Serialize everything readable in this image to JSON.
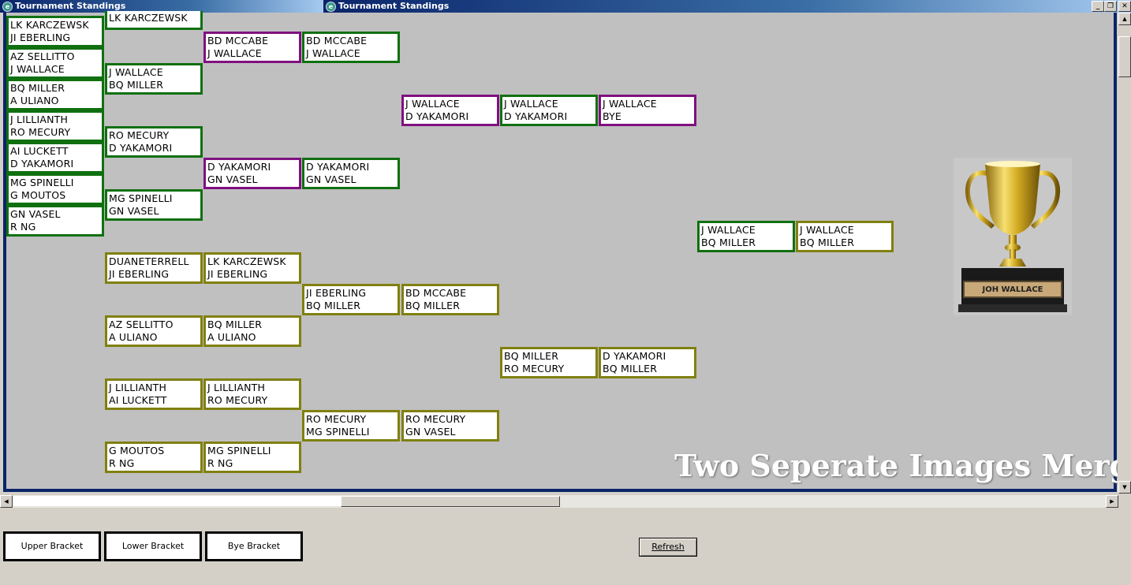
{
  "windows": [
    {
      "title": "Tournament Standings"
    },
    {
      "title": "Tournament Standings"
    }
  ],
  "window_controls": {
    "minimize": "_",
    "restore": "❐",
    "close": "✕"
  },
  "matches": [
    {
      "p1": "LK KARCZEWSK",
      "p2": "JI EBERLING",
      "bracket": "upper"
    },
    {
      "p1": "AZ SELLITTO",
      "p2": "J WALLACE",
      "bracket": "upper"
    },
    {
      "p1": "BQ MILLER",
      "p2": "A ULIANO",
      "bracket": "upper"
    },
    {
      "p1": "J LILLIANTH",
      "p2": "RO MECURY",
      "bracket": "upper"
    },
    {
      "p1": "AI LUCKETT",
      "p2": "D YAKAMORI",
      "bracket": "upper"
    },
    {
      "p1": "MG SPINELLI",
      "p2": "G MOUTOS",
      "bracket": "upper"
    },
    {
      "p1": "GN VASEL",
      "p2": "R NG",
      "bracket": "upper"
    },
    {
      "p1": "LK KARCZEWSK",
      "p2": "",
      "bracket": "upper"
    },
    {
      "p1": "J WALLACE",
      "p2": "BQ MILLER",
      "bracket": "upper"
    },
    {
      "p1": "RO MECURY",
      "p2": "D YAKAMORI",
      "bracket": "upper"
    },
    {
      "p1": "MG SPINELLI",
      "p2": "GN VASEL",
      "bracket": "upper"
    },
    {
      "p1": "BD MCCABE",
      "p2": "J WALLACE",
      "bracket": "bye"
    },
    {
      "p1": "D YAKAMORI",
      "p2": "GN VASEL",
      "bracket": "bye"
    },
    {
      "p1": "BD MCCABE",
      "p2": "J WALLACE",
      "bracket": "upper"
    },
    {
      "p1": "D YAKAMORI",
      "p2": "GN VASEL",
      "bracket": "upper"
    },
    {
      "p1": "J WALLACE",
      "p2": "D YAKAMORI",
      "bracket": "bye"
    },
    {
      "p1": "J WALLACE",
      "p2": "D YAKAMORI",
      "bracket": "upper"
    },
    {
      "p1": "J WALLACE",
      "p2": "BYE",
      "bracket": "bye"
    },
    {
      "p1": "J WALLACE",
      "p2": "BQ MILLER",
      "bracket": "upper"
    },
    {
      "p1": "J WALLACE",
      "p2": "BQ MILLER",
      "bracket": "lower"
    },
    {
      "p1": "DUANETERRELL",
      "p2": "JI EBERLING",
      "bracket": "lower"
    },
    {
      "p1": "AZ SELLITTO",
      "p2": "A ULIANO",
      "bracket": "lower"
    },
    {
      "p1": "J LILLIANTH",
      "p2": "AI LUCKETT",
      "bracket": "lower"
    },
    {
      "p1": "G MOUTOS",
      "p2": "R NG",
      "bracket": "lower"
    },
    {
      "p1": "LK KARCZEWSK",
      "p2": "JI EBERLING",
      "bracket": "lower"
    },
    {
      "p1": "BQ MILLER",
      "p2": "A ULIANO",
      "bracket": "lower"
    },
    {
      "p1": "J LILLIANTH",
      "p2": "RO MECURY",
      "bracket": "lower"
    },
    {
      "p1": "MG SPINELLI",
      "p2": "R NG",
      "bracket": "lower"
    },
    {
      "p1": "JI EBERLING",
      "p2": "BQ MILLER",
      "bracket": "lower"
    },
    {
      "p1": "RO MECURY",
      "p2": "MG SPINELLI",
      "bracket": "lower"
    },
    {
      "p1": "BD MCCABE",
      "p2": "BQ MILLER",
      "bracket": "lower"
    },
    {
      "p1": "RO MECURY",
      "p2": "GN VASEL",
      "bracket": "lower"
    },
    {
      "p1": "BQ MILLER",
      "p2": "RO MECURY",
      "bracket": "lower"
    },
    {
      "p1": "D YAKAMORI",
      "p2": "BQ MILLER",
      "bracket": "lower"
    }
  ],
  "trophy": {
    "plate_text": "JOH WALLACE"
  },
  "watermark": "Two Seperate Images Merged",
  "legend": {
    "upper": "Upper Bracket",
    "lower": "Lower Bracket",
    "bye": "Bye Bracket"
  },
  "refresh_label": "Refresh",
  "colors": {
    "upper": "#107010",
    "lower": "#808010",
    "bye": "#801080",
    "title_bar": "#0a246a"
  }
}
